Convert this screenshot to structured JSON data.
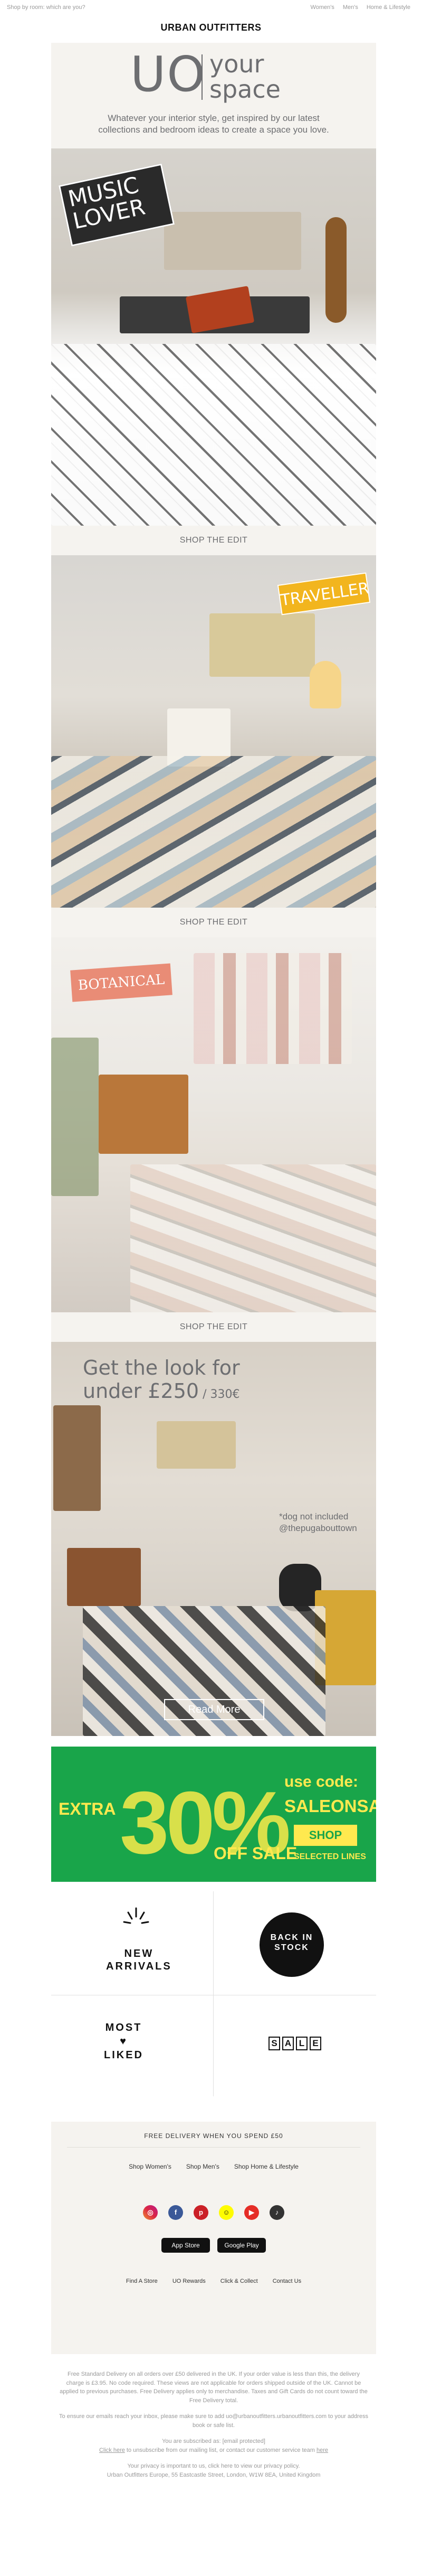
{
  "preheader": "Shop by room: which are you?",
  "nav": [
    "Women's",
    "Men's",
    "Home & Lifestyle"
  ],
  "brand": "URBAN OUTFITTERS",
  "hero": {
    "uo": "UO",
    "your": "your",
    "space": "space",
    "intro": "Whatever your interior style, get inspired by our latest collections and bedroom ideas to create a space you love."
  },
  "panels": [
    {
      "sticker": "MUSIC LOVER",
      "cta": "SHOP THE EDIT"
    },
    {
      "sticker": "TRAVELLER",
      "cta": "SHOP THE EDIT"
    },
    {
      "sticker": "BOTANICAL",
      "cta": "SHOP THE EDIT"
    }
  ],
  "look": {
    "line1": "Get the look for",
    "line2": "under £250",
    "price_eur": " / 330€",
    "note1": "*dog not included",
    "note2": "@thepugabouttown",
    "button": "Read More"
  },
  "sale": {
    "extra": "EXTRA",
    "percent": "30%",
    "off": "OFF SALE",
    "use": "use code:",
    "code": "SALEONSALE",
    "shop": "SHOP",
    "selected": "SELECTED LINES",
    "colors": {
      "bg": "#19a54a",
      "text": "#ffe94f"
    }
  },
  "tiles": {
    "new_arrivals": [
      "NEW",
      "ARRIVALS"
    ],
    "back_in_stock": [
      "BACK IN",
      "STOCK"
    ],
    "most_liked": [
      "MOST",
      "LIKED"
    ],
    "sale_letters": [
      "S",
      "A",
      "L",
      "E"
    ]
  },
  "footer": {
    "free_delivery": "FREE DELIVERY WHEN YOU SPEND £50",
    "shops": [
      "Shop Women's",
      "Shop Men's",
      "Shop Home & Lifestyle"
    ],
    "app_store": "App Store",
    "google_play": "Google Play",
    "links": [
      "Find A Store",
      "UO Rewards",
      "Click & Collect",
      "Contact Us"
    ]
  },
  "legal": {
    "p1": "Free Standard Delivery on all orders over £50 delivered in the UK. If your order value is less than this, the delivery charge is £3.95. No code required. These views are not applicable for orders shipped outside of the UK. Cannot be applied to previous purchases. Free Delivery applies only to merchandise. Taxes and Gift Cards do not count toward the Free Delivery total.",
    "p2": "To ensure our emails reach your inbox, please make sure to add uo@urbanoutfitters.urbanoutfitters.com to your address book or safe list.",
    "p3": "You are subscribed as: [email protected]",
    "p4a": "Click here",
    "p4b": " to unsubscribe from our mailing list, or contact our customer service team ",
    "p4c": "here",
    "p5": "Your privacy is important to us, click here to view our privacy policy.",
    "p6": "Urban Outfitters Europe, 55 Eastcastle Street, London, W1W 8EA, United Kingdom"
  }
}
